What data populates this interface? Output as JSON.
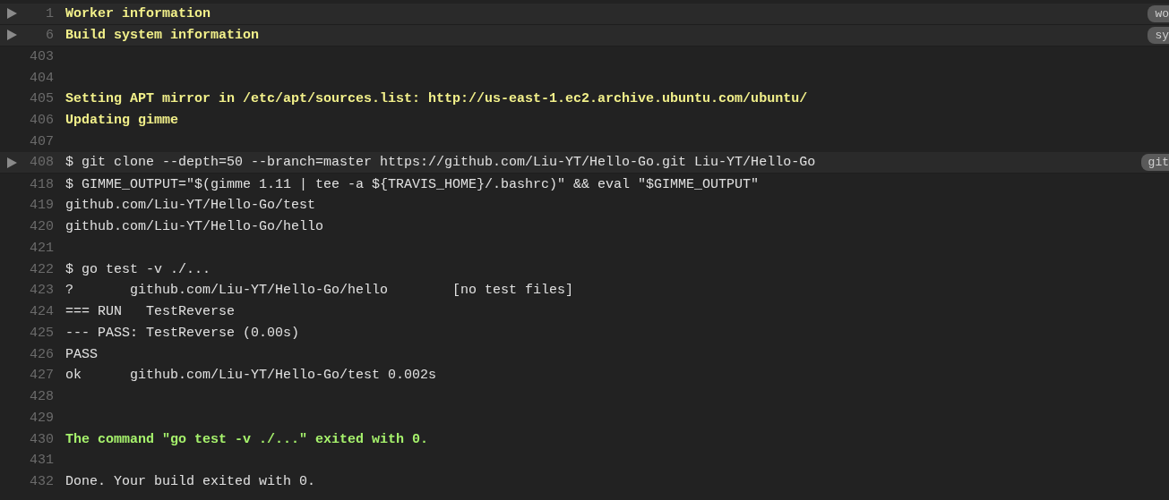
{
  "log_lines": [
    {
      "kind": "fold",
      "number": "1",
      "text": "Worker information",
      "color": "#f2f08a",
      "bold": true,
      "badge": "wo"
    },
    {
      "kind": "fold",
      "number": "6",
      "text": "Build system information",
      "color": "#f2f08a",
      "bold": true,
      "badge": "sy"
    },
    {
      "kind": "line",
      "number": "403"
    },
    {
      "kind": "line",
      "number": "404"
    },
    {
      "kind": "line",
      "number": "405",
      "text": "Setting APT mirror in /etc/apt/sources.list: http://us-east-1.ec2.archive.ubuntu.com/ubuntu/",
      "color": "#f2f08a",
      "bold": true
    },
    {
      "kind": "line",
      "number": "406",
      "text": "Updating gimme",
      "color": "#f2f08a",
      "bold": true
    },
    {
      "kind": "line",
      "number": "407"
    },
    {
      "kind": "fold",
      "number": "408",
      "text": "$ git clone --depth=50 --branch=master https://github.com/Liu-YT/Hello-Go.git Liu-YT/Hello-Go",
      "color": "#e0e0e0",
      "bold": false,
      "badge": "git"
    },
    {
      "kind": "line",
      "number": "418",
      "text": "$ GIMME_OUTPUT=\"$(gimme 1.11 | tee -a ${TRAVIS_HOME}/.bashrc)\" && eval \"$GIMME_OUTPUT\"",
      "color": "#e0e0e0",
      "bold": false
    },
    {
      "kind": "line",
      "number": "419",
      "text": "github.com/Liu-YT/Hello-Go/test",
      "color": "#e0e0e0",
      "bold": false
    },
    {
      "kind": "line",
      "number": "420",
      "text": "github.com/Liu-YT/Hello-Go/hello",
      "color": "#e0e0e0",
      "bold": false
    },
    {
      "kind": "line",
      "number": "421"
    },
    {
      "kind": "line",
      "number": "422",
      "text": "$ go test -v ./...",
      "color": "#e0e0e0",
      "bold": false
    },
    {
      "kind": "line",
      "number": "423",
      "text": "?       github.com/Liu-YT/Hello-Go/hello        [no test files]",
      "color": "#e0e0e0",
      "bold": false
    },
    {
      "kind": "line",
      "number": "424",
      "text": "=== RUN   TestReverse",
      "color": "#e0e0e0",
      "bold": false
    },
    {
      "kind": "line",
      "number": "425",
      "text": "--- PASS: TestReverse (0.00s)",
      "color": "#e0e0e0",
      "bold": false
    },
    {
      "kind": "line",
      "number": "426",
      "text": "PASS",
      "color": "#e0e0e0",
      "bold": false
    },
    {
      "kind": "line",
      "number": "427",
      "text": "ok      github.com/Liu-YT/Hello-Go/test 0.002s",
      "color": "#e0e0e0",
      "bold": false
    },
    {
      "kind": "line",
      "number": "428"
    },
    {
      "kind": "line",
      "number": "429"
    },
    {
      "kind": "line",
      "number": "430",
      "text": "The command \"go test -v ./...\" exited with 0.",
      "color": "#a6f26c",
      "bold": true
    },
    {
      "kind": "line",
      "number": "431"
    },
    {
      "kind": "line",
      "number": "432",
      "text": "Done. Your build exited with 0.",
      "color": "#e0e0e0",
      "bold": false
    }
  ]
}
